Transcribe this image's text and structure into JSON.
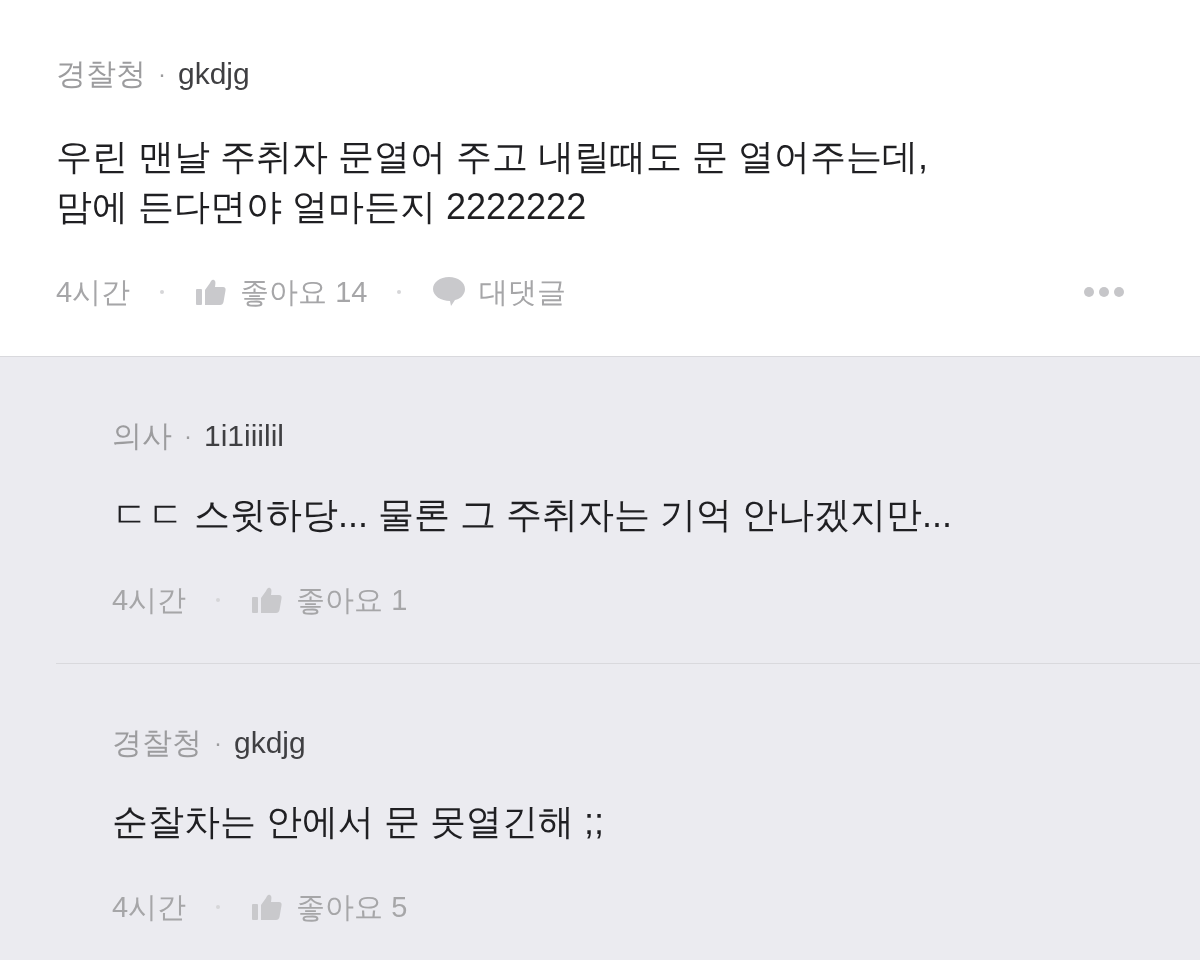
{
  "comment": {
    "author": {
      "affiliation": "경찰청",
      "separator": "·",
      "username": "gkdjg"
    },
    "body": "우린 맨날 주취자 문열어 주고 내릴때도 문 열어주는데,\n맘에 든다면야 얼마든지 2222222",
    "time": "4시간",
    "like_label": "좋아요 14",
    "reply_label": "대댓글"
  },
  "replies": [
    {
      "author": {
        "affiliation": "의사",
        "separator": "·",
        "username": "1i1iiilil"
      },
      "body": "ㄷㄷ 스윗하당... 물론 그 주취자는 기억 안나겠지만...",
      "time": "4시간",
      "like_label": "좋아요 1"
    },
    {
      "author": {
        "affiliation": "경찰청",
        "separator": "·",
        "username": "gkdjg"
      },
      "body": "순찰차는 안에서 문 못열긴해 ;;",
      "time": "4시간",
      "like_label": "좋아요 5"
    }
  ]
}
